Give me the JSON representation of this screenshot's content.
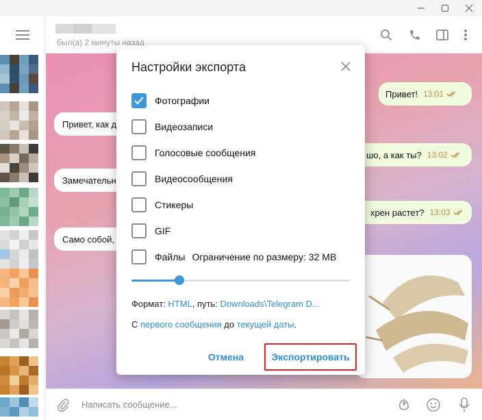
{
  "window": {
    "minimize_icon": "minimize-icon",
    "maximize_icon": "maximize-icon",
    "close_icon": "close-icon"
  },
  "header": {
    "status": "был(а) 2 минуты назад"
  },
  "messages": {
    "in": [
      {
        "text": "Привет, как д"
      },
      {
        "text": "Замечательн"
      },
      {
        "text": "Само собой,"
      }
    ],
    "out": [
      {
        "text": "Привет!",
        "time": "13:01"
      },
      {
        "text": "шо, а как ты?",
        "time": "13:02"
      },
      {
        "text": "хрен растет?",
        "time": "13:03"
      }
    ]
  },
  "composer": {
    "placeholder": "Написать сообщение..."
  },
  "dialog": {
    "title": "Настройки экспорта",
    "options": [
      {
        "label": "Фотографии",
        "checked": true
      },
      {
        "label": "Видеозаписи",
        "checked": false
      },
      {
        "label": "Голосовые сообщения",
        "checked": false
      },
      {
        "label": "Видеосообщения",
        "checked": false
      },
      {
        "label": "Стикеры",
        "checked": false
      },
      {
        "label": "GIF",
        "checked": false
      },
      {
        "label": "Файлы",
        "checked": false
      }
    ],
    "size_limit": "Ограничение по размеру: 32 MB",
    "slider_fraction": 0.22,
    "format_prefix": "Формат:",
    "format_value": "HTML",
    "path_prefix": ", путь:",
    "path_value": "Downloads\\Telegram D...",
    "range_from_prefix": "С",
    "range_from": "первого сообщения",
    "range_mid": "до",
    "range_to": "текущей даты",
    "range_suffix": ".",
    "cancel_label": "Отмена",
    "export_label": "Экспортировать"
  },
  "colors": {
    "accent": "#3e97d9",
    "link": "#2e8fd6",
    "highlight": "#e02020"
  }
}
